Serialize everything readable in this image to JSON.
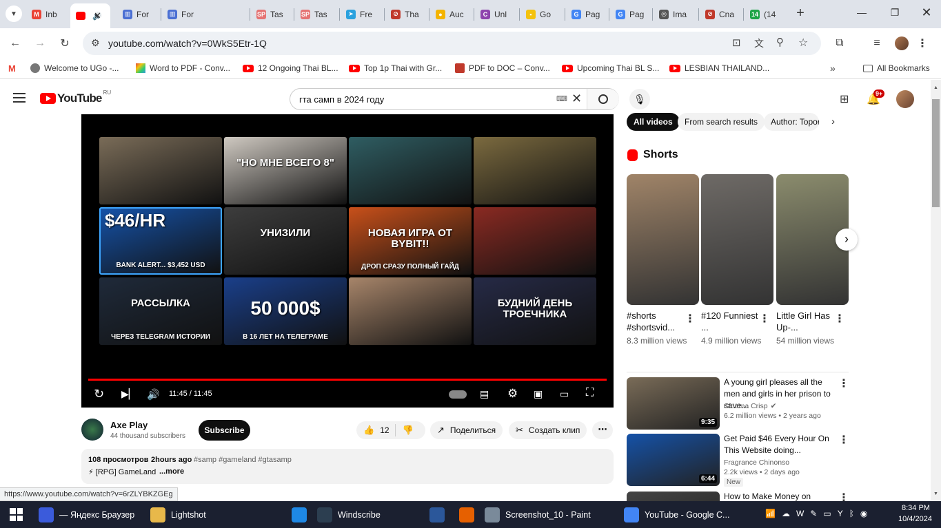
{
  "tabs": [
    {
      "label": "Inb",
      "fav": "M",
      "color": "#ea4335",
      "icon": "gmail-icon"
    },
    {
      "label": "",
      "fav": "",
      "color": "#f00",
      "icon": "youtube-icon"
    },
    {
      "label": "For",
      "fav": "▥",
      "color": "#4a6fd3",
      "icon": "form-icon"
    },
    {
      "label": "For",
      "fav": "▥",
      "color": "#4a6fd3",
      "icon": "form-icon"
    },
    {
      "label": "Tas",
      "fav": "SP",
      "color": "#e57373",
      "icon": "sp-icon"
    },
    {
      "label": "Tas",
      "fav": "SP",
      "color": "#e57373",
      "icon": "sp-icon"
    },
    {
      "label": "Fre",
      "fav": "➤",
      "color": "#2aa1de",
      "icon": "telegram-icon"
    },
    {
      "label": "Tha",
      "fav": "⊘",
      "color": "#c0392b",
      "icon": "pinterest-like-icon"
    },
    {
      "label": "Auc",
      "fav": "●",
      "color": "#f4b400",
      "icon": "colorful-icon"
    },
    {
      "label": "Unl",
      "fav": "C",
      "color": "#8e44ad",
      "icon": "circle-c-icon"
    },
    {
      "label": "Go",
      "fav": "▪",
      "color": "#f4c20d",
      "icon": "keep-icon"
    },
    {
      "label": "Pag",
      "fav": "G",
      "color": "#4285f4",
      "icon": "google-icon"
    },
    {
      "label": "Pag",
      "fav": "G",
      "color": "#4285f4",
      "icon": "google-icon"
    },
    {
      "label": "Ima",
      "fav": "◎",
      "color": "#555",
      "icon": "image-icon"
    },
    {
      "label": "Cna",
      "fav": "⊘",
      "color": "#c0392b",
      "icon": "pin-icon"
    },
    {
      "label": "(14",
      "fav": "14",
      "color": "#1ea446",
      "icon": "badge-icon"
    }
  ],
  "address": {
    "url": "youtube.com/watch?v=0WkS5Etr-1Q"
  },
  "bookmarks": [
    {
      "label": "Welcome to UGo -...",
      "icon": "ugo-icon"
    },
    {
      "label": "Word to PDF - Conv...",
      "icon": "wordpdf-icon"
    },
    {
      "label": "12 Ongoing Thai BL...",
      "icon": "youtube-icon"
    },
    {
      "label": "Top 1p Thai with Gr...",
      "icon": "youtube-icon"
    },
    {
      "label": "PDF to DOC – Conv...",
      "icon": "pdfdoc-icon"
    },
    {
      "label": "Upcoming Thai BL S...",
      "icon": "youtube-icon"
    },
    {
      "label": "LESBIAN THAILAND...",
      "icon": "youtube-icon"
    }
  ],
  "all_bookmarks": "All Bookmarks",
  "yt": {
    "logo": "YouTube",
    "logo_region": "RU",
    "search_value": "гта самп в 2024 году",
    "notif_count": "9+",
    "player": {
      "time": "11:45 / 11:45",
      "progress": 1.0,
      "thumbs": [
        {
          "text": "",
          "bg": "#7a6c58"
        },
        {
          "text": "\"НО МНЕ ВСЕГО 8\"",
          "bg": "#cfc9c1"
        },
        {
          "text": "",
          "bg": "#2f5d62"
        },
        {
          "text": "",
          "bg": "#7b6a3f"
        },
        {
          "text": "$46/HR",
          "sub": "BANK ALERT... $3,452 USD",
          "bg": "#1552a8"
        },
        {
          "text": "УНИЗИЛИ",
          "bg": "#3d3d3d"
        },
        {
          "text": "НОВАЯ ИГРА ОТ BYBIT!!",
          "sub": "ДРОП СРАЗУ ПОЛНЫЙ ГАЙД",
          "bg": "#c8501a"
        },
        {
          "text": "",
          "bg": "#8a2a22"
        },
        {
          "text": "РАССЫЛКА",
          "sub": "ЧЕРЕЗ TELEGRAM ИСТОРИИ",
          "bg": "#1f2a3a"
        },
        {
          "text": "50 000$",
          "sub": "В 16 ЛЕТ НА ТЕЛЕГРАМЕ",
          "bg": "#1a3f8a"
        },
        {
          "text": "",
          "bg": "#a7856a"
        },
        {
          "text": "БУДНИЙ ДЕНЬ ТРОЕЧНИКА",
          "bg": "#262a46"
        }
      ]
    },
    "channel": {
      "name": "Axe Play",
      "subs": "44 thousand subscribers",
      "subscribe": "Subscribe"
    },
    "actions": {
      "likes": "12",
      "share": "Поделиться",
      "clip": "Создать клип"
    },
    "description": {
      "views": "108 просмотров",
      "time": "2hours ago",
      "tags": "#samp #gameland #gtasamp",
      "text": "⚡ [RPG] GameLand",
      "more": "...more"
    },
    "filters": [
      "All videos",
      "From search results",
      "Author: Topor"
    ],
    "shorts_header": "Shorts",
    "shorts": [
      {
        "title": "#shorts #shortsvid...",
        "views": "8.3 million views",
        "bg": "#a08468"
      },
      {
        "title": "#120 Funniest ...",
        "views": "4.9 million views",
        "bg": "#6e6a66"
      },
      {
        "title": "Little Girl Has Up-...",
        "views": "54 million views",
        "bg": "#8b8c6d"
      }
    ],
    "videos": [
      {
        "title": "A young girl pleases all the men and girls in her prison to save...",
        "channel": "Cinema Crisp",
        "verified": true,
        "meta": "6.2 million views • 2 years ago",
        "duration": "9:35",
        "bg": "#7a6c58",
        "badge": ""
      },
      {
        "title": "Get Paid $46 Every Hour On This Website doing...",
        "channel": "Fragrance Chinonso",
        "verified": false,
        "meta": "2.2k views • 2 days ago",
        "duration": "6:44",
        "bg": "#1552a8",
        "badge": "New"
      },
      {
        "title": "How to Make Money on",
        "channel": "",
        "verified": false,
        "meta": "",
        "duration": "",
        "bg": "#444",
        "badge": ""
      }
    ],
    "status_url": "https://www.youtube.com/watch?v=6rZLYBKZGEg"
  },
  "taskbar": {
    "apps": [
      {
        "label": "— Яндекс Браузер",
        "icon": "yandex-icon",
        "color": "#3b5bdb"
      },
      {
        "label": "Lightshot",
        "icon": "folder-icon",
        "color": "#e8b84a"
      },
      {
        "label": "",
        "icon": "chat-icon",
        "color": "#1e88e5"
      },
      {
        "label": "Windscribe",
        "icon": "windscribe-icon",
        "color": "#2c3e50"
      },
      {
        "label": "",
        "icon": "word-icon",
        "color": "#2b579a"
      },
      {
        "label": "",
        "icon": "firefox-icon",
        "color": "#e66000"
      },
      {
        "label": "Screenshot_10 - Paint",
        "icon": "paint-icon",
        "color": "#7a8a9a"
      },
      {
        "label": "YouTube - Google C...",
        "icon": "chrome-icon",
        "color": "#4285f4"
      }
    ],
    "time": "8:34 PM",
    "date": "10/4/2024"
  }
}
